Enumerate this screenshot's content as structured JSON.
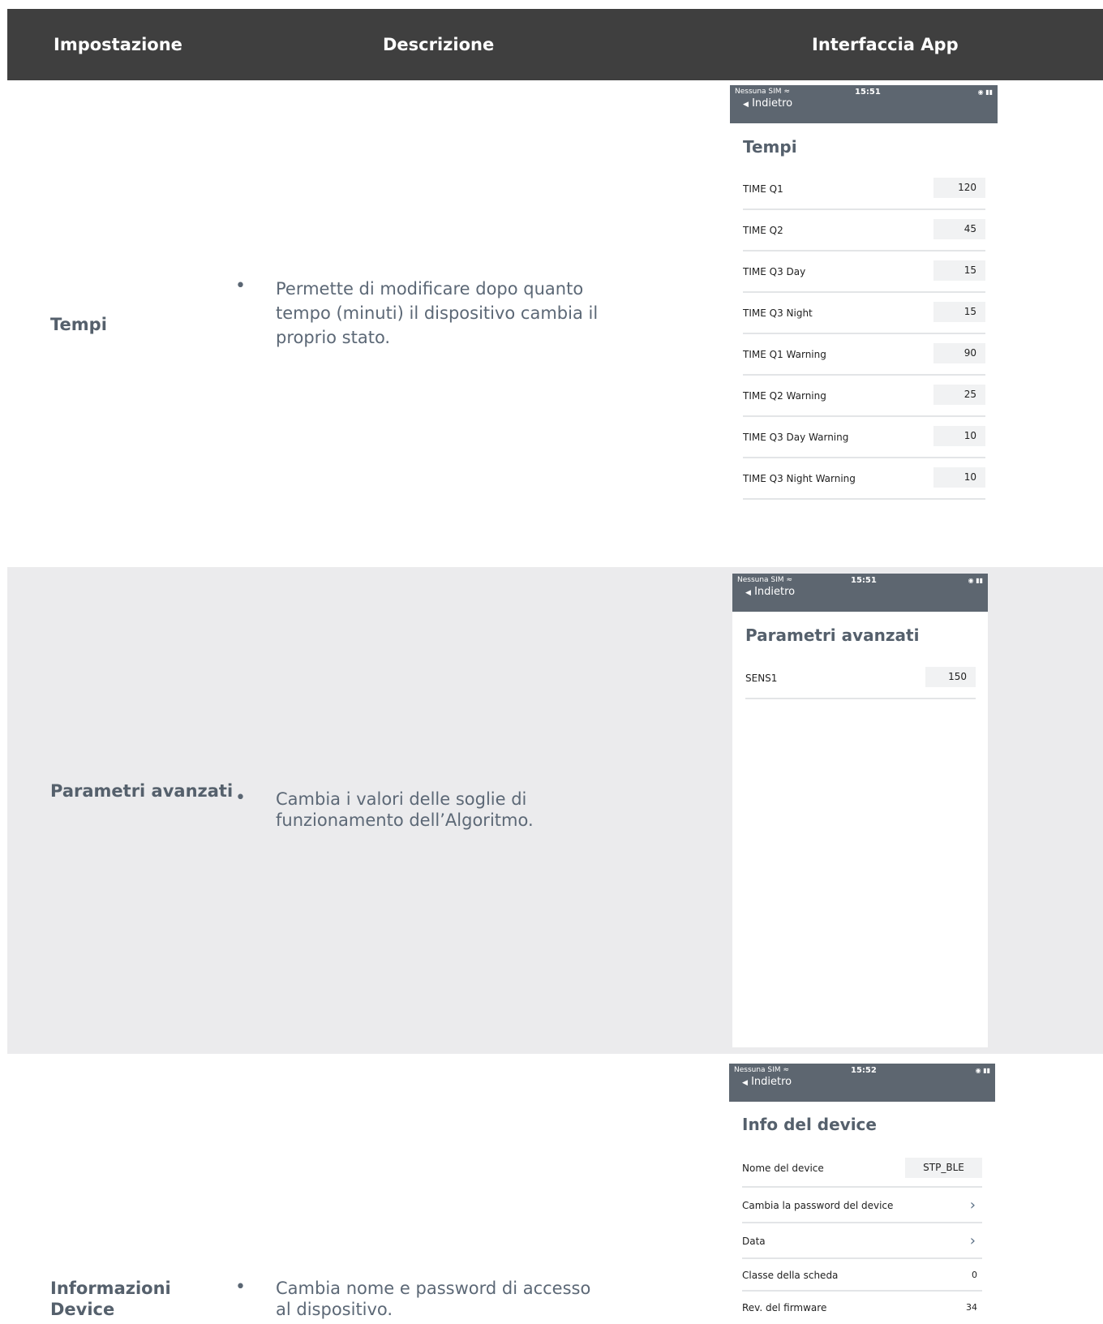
{
  "header": {
    "col_setting": "Impostazione",
    "col_description": "Descrizione",
    "col_app": "Interfaccia App"
  },
  "status_bar": {
    "carrier": "Nessuna SIM",
    "back_label": "Indietro"
  },
  "sections": {
    "tempi": {
      "setting": "Tempi",
      "bullet": "•",
      "description": "Permette di modificare dopo quanto tempo (minuti) il dispositivo cambia il proprio stato.",
      "phone": {
        "time": "15:51",
        "title": "Tempi",
        "rows": [
          {
            "label": "TIME Q1",
            "value": "120"
          },
          {
            "label": "TIME Q2",
            "value": "45"
          },
          {
            "label": "TIME Q3 Day",
            "value": "15"
          },
          {
            "label": "TIME Q3 Night",
            "value": "15"
          },
          {
            "label": "TIME Q1 Warning",
            "value": "90"
          },
          {
            "label": "TIME Q2 Warning",
            "value": "25"
          },
          {
            "label": "TIME Q3 Day Warning",
            "value": "10"
          },
          {
            "label": "TIME Q3 Night Warning",
            "value": "10"
          }
        ]
      }
    },
    "parametri": {
      "setting": "Parametri avanzati",
      "bullet": "•",
      "description": "Cambia i valori delle soglie di funzionamento dell’Algoritmo.",
      "phone": {
        "time": "15:51",
        "title": "Parametri avanzati",
        "rows": [
          {
            "label": "SENS1",
            "value": "150"
          }
        ]
      }
    },
    "info": {
      "setting": "Informazioni Device",
      "bullet": "•",
      "description": "Cambia nome e password di accesso al dispositivo.",
      "phone": {
        "time": "15:52",
        "title": "Info del device",
        "rows": [
          {
            "label": "Nome del device",
            "value": "STP_BLE"
          },
          {
            "label": "Cambia la password del device"
          },
          {
            "label": "Data"
          },
          {
            "label": "Classe della scheda",
            "value": "0"
          },
          {
            "label": "Rev. del firmware",
            "value": "34"
          }
        ]
      }
    }
  },
  "colors": {
    "header_bg": "#3f3f3f",
    "grey_section_bg": "#ebebed",
    "phone_bar_bg": "#5d6670",
    "text": "#5a6673"
  }
}
